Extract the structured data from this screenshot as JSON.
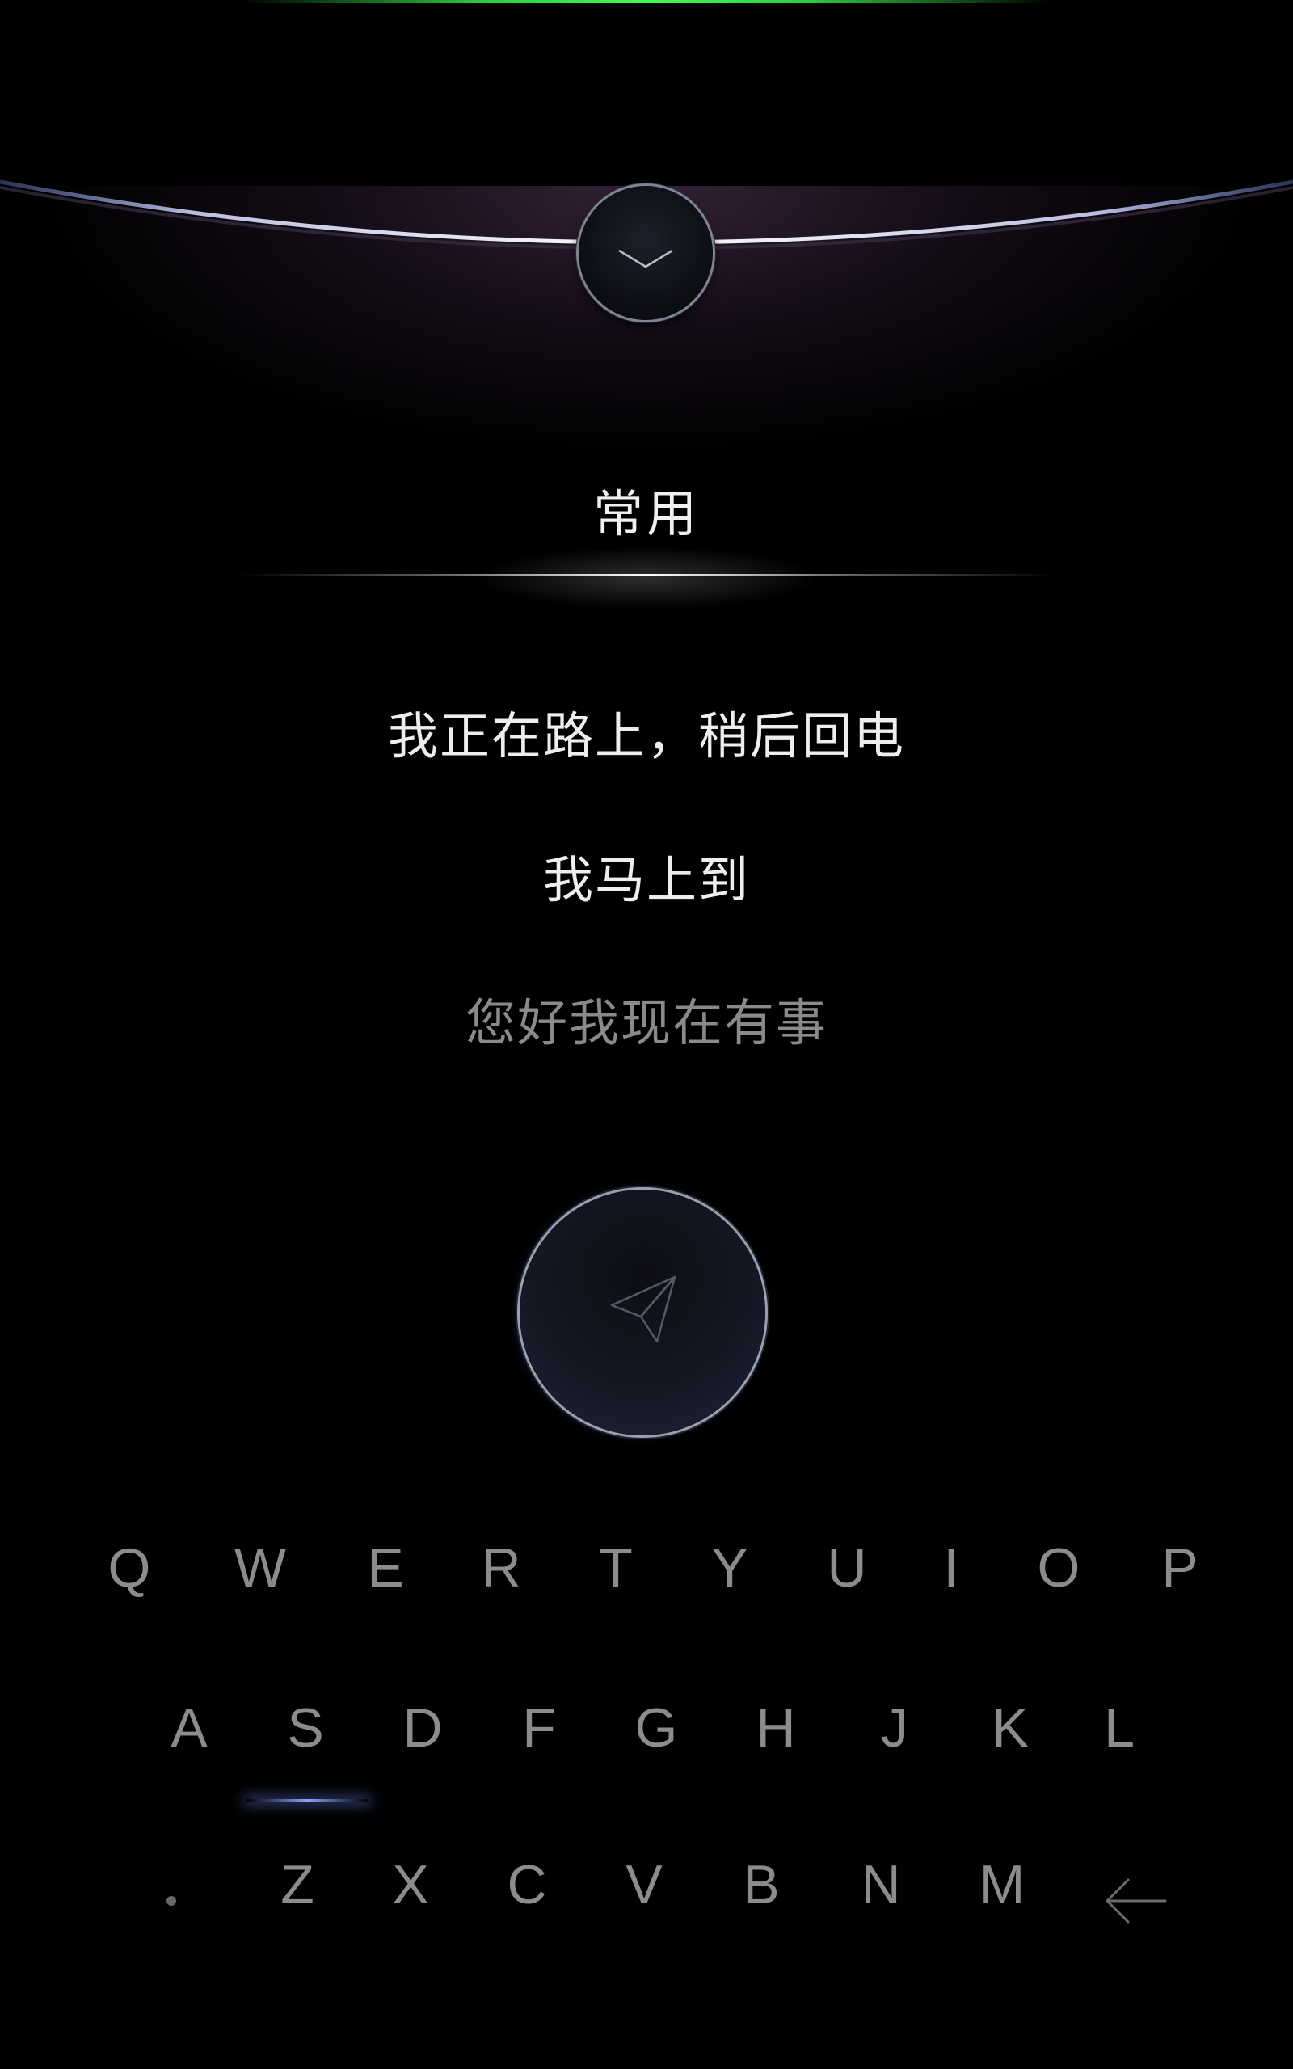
{
  "category": {
    "label": "常用"
  },
  "quick_replies": [
    {
      "text": "我正在路上，稍后回电"
    },
    {
      "text": "我马上到"
    },
    {
      "text": "您好我现在有事"
    }
  ],
  "keyboard": {
    "row1": [
      "Q",
      "W",
      "E",
      "R",
      "T",
      "Y",
      "U",
      "I",
      "O",
      "P"
    ],
    "row2": [
      "A",
      "S",
      "D",
      "F",
      "G",
      "H",
      "J",
      "K",
      "L"
    ],
    "row3": [
      "Z",
      "X",
      "C",
      "V",
      "B",
      "N",
      "M"
    ],
    "highlighted_key": "S"
  },
  "icons": {
    "collapse": "chevron-down-icon",
    "send": "paper-plane-icon",
    "backspace": "arrow-left-icon",
    "dot": "dot-icon"
  },
  "colors": {
    "accent_green": "#3cff50",
    "highlight_blue": "#8aa2ff",
    "background": "#000000"
  }
}
